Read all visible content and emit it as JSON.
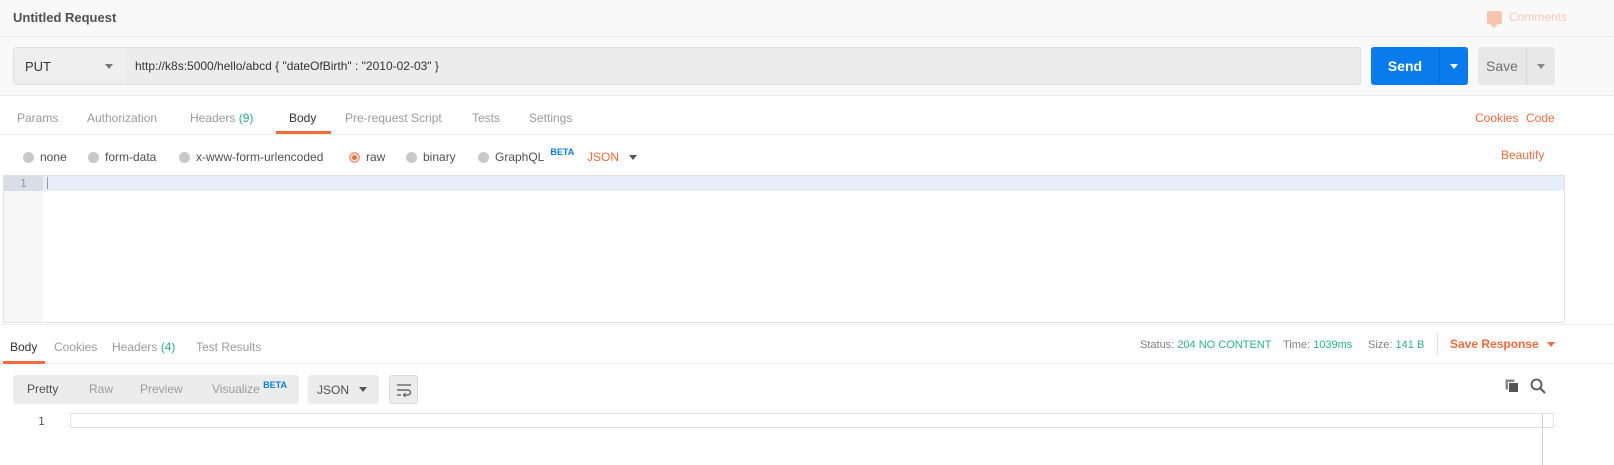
{
  "header": {
    "title": "Untitled Request",
    "comments_label": "Comments"
  },
  "request": {
    "method": "PUT",
    "url": "http://k8s:5000/hello/abcd { \"dateOfBirth\" : \"2010-02-03\" }",
    "send_label": "Send",
    "save_label": "Save"
  },
  "request_tabs": {
    "params": "Params",
    "authorization": "Authorization",
    "headers": "Headers",
    "headers_count": "(9)",
    "body": "Body",
    "prerequest": "Pre-request Script",
    "tests": "Tests",
    "settings": "Settings",
    "cookies": "Cookies",
    "code": "Code"
  },
  "body_options": {
    "none": "none",
    "form_data": "form-data",
    "urlencoded": "x-www-form-urlencoded",
    "raw": "raw",
    "binary": "binary",
    "graphql": "GraphQL",
    "beta": "BETA",
    "format": "JSON",
    "beautify": "Beautify",
    "selected": "raw"
  },
  "editor": {
    "line_number": "1"
  },
  "response": {
    "tabs": {
      "body": "Body",
      "cookies": "Cookies",
      "headers": "Headers",
      "headers_count": "(4)",
      "test_results": "Test Results"
    },
    "status_label": "Status:",
    "status_value": "204 NO CONTENT",
    "time_label": "Time:",
    "time_value": "1039ms",
    "size_label": "Size:",
    "size_value": "141 B",
    "save_response": "Save Response",
    "views": {
      "pretty": "Pretty",
      "raw": "Raw",
      "preview": "Preview",
      "visualize": "Visualize",
      "beta": "BETA"
    },
    "format": "JSON",
    "line_number": "1"
  },
  "colors": {
    "accent": "#f26b3a",
    "send_blue": "#097bed",
    "success_green": "#26b47f"
  }
}
